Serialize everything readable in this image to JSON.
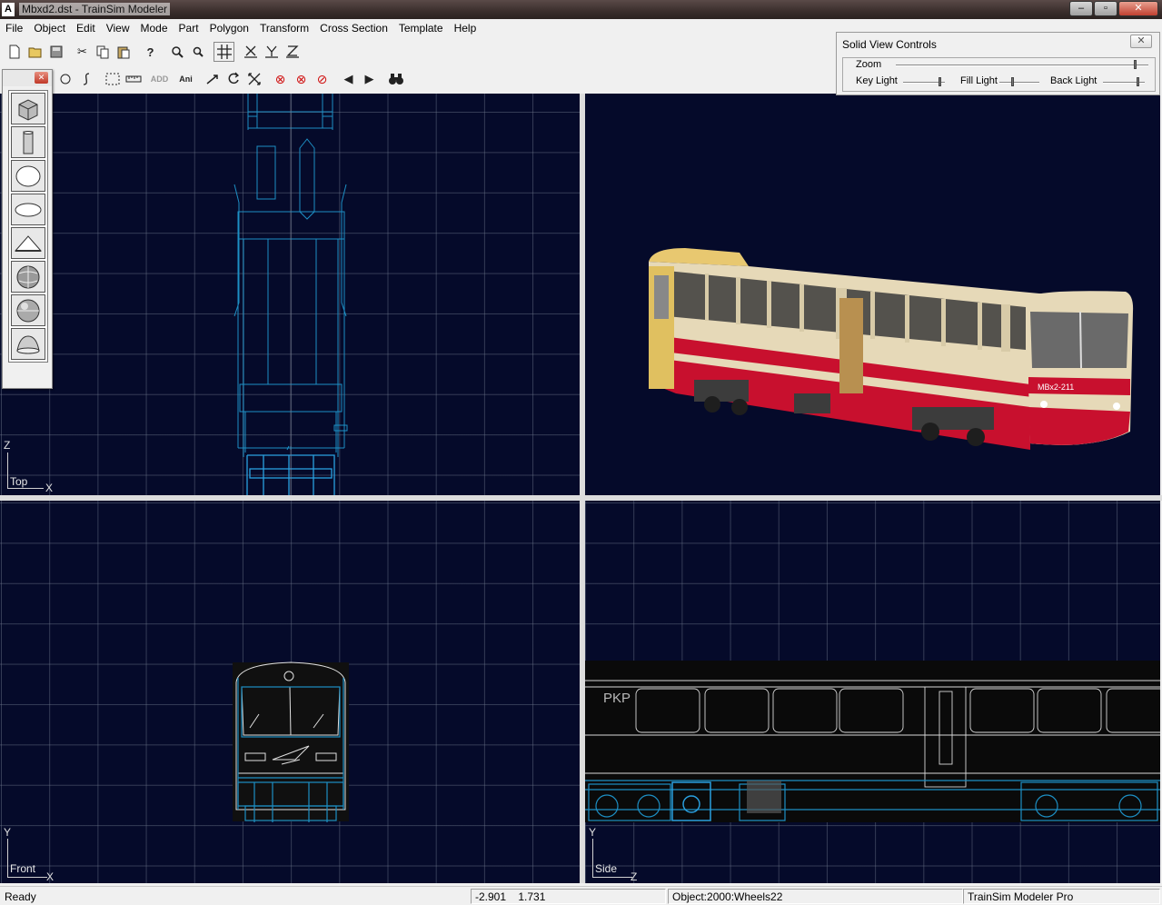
{
  "window": {
    "title": "Mbxd2.dst - TrainSim Modeler",
    "app_icon": "A",
    "minimize": "–",
    "maximize": "▫",
    "close": "✕"
  },
  "menu": [
    "File",
    "Object",
    "Edit",
    "View",
    "Mode",
    "Part",
    "Polygon",
    "Transform",
    "Cross Section",
    "Template",
    "Help"
  ],
  "toolbar": {
    "row1": [
      "new-icon",
      "open-icon",
      "save-icon",
      "cut-icon",
      "copy-icon",
      "paste-icon",
      "help-icon",
      "zoom-in-icon",
      "zoom-out-icon",
      "grid-icon",
      "axis-x-icon",
      "axis-y-icon",
      "axis-z-icon"
    ],
    "row2_text": {
      "add": "ADD",
      "ani": "Ani"
    }
  },
  "palette": {
    "close": "✕",
    "primitives": [
      "box-primitive-icon",
      "cylinder-primitive-icon",
      "sphere-primitive-icon",
      "ellipsoid-primitive-icon",
      "pyramid-primitive-icon",
      "textured-sphere-icon",
      "shaded-sphere-icon",
      "dome-primitive-icon"
    ]
  },
  "solid_view_controls": {
    "title": "Solid View Controls",
    "close": "✕",
    "zoom_label": "Zoom",
    "key_light_label": "Key Light",
    "fill_light_label": "Fill Light",
    "back_light_label": "Back Light",
    "zoom_level": 0.95,
    "key_light_level": 0.9,
    "fill_light_level": 0.35,
    "back_light_level": 0.85
  },
  "viewports": {
    "top": {
      "name": "Top",
      "axis_v": "Z",
      "axis_h": "X"
    },
    "front": {
      "name": "Front",
      "axis_v": "Y",
      "axis_h": "X"
    },
    "side": {
      "name": "Side",
      "axis_v": "Y",
      "axis_h": "Z"
    },
    "solid": {
      "car_number": "МВх2-211",
      "side_logo": "PKP"
    }
  },
  "status": {
    "state": "Ready",
    "coord_x": "-2.901",
    "coord_y": "1.731",
    "object": "Object:2000:Wheels22",
    "product": "TrainSim Modeler Pro"
  },
  "colors": {
    "viewport_bg": "#050a2a",
    "wire": "#1d8fc4",
    "wire_selected": "#2aa0e0",
    "train_body": "#e6d9b8",
    "train_stripe": "#c8102e"
  }
}
